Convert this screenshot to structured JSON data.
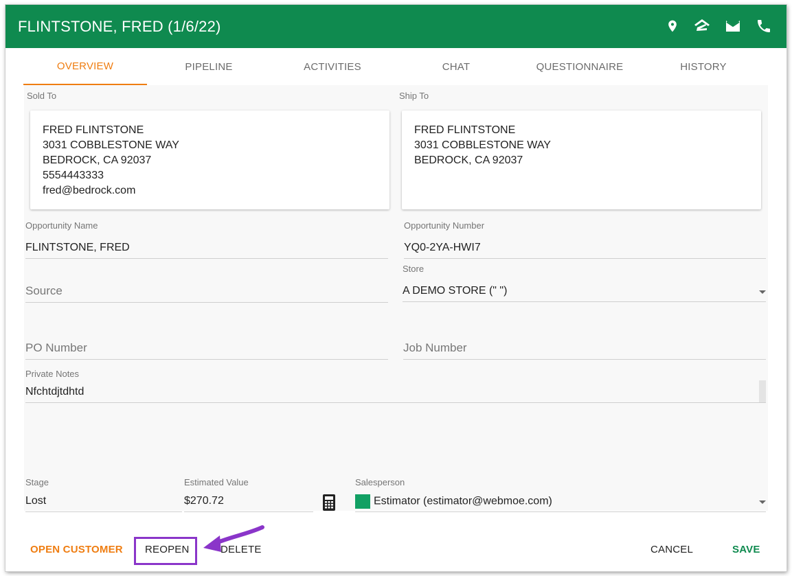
{
  "header": {
    "title": "FLINTSTONE, FRED (1/6/22)",
    "icons": [
      "location-pin-icon",
      "zillow-icon",
      "email-icon",
      "phone-icon"
    ]
  },
  "tabs": [
    {
      "label": "OVERVIEW",
      "active": true
    },
    {
      "label": "PIPELINE",
      "active": false
    },
    {
      "label": "ACTIVITIES",
      "active": false
    },
    {
      "label": "CHAT",
      "active": false
    },
    {
      "label": "QUESTIONNAIRE",
      "active": false
    },
    {
      "label": "HISTORY",
      "active": false
    }
  ],
  "sold_to": {
    "label": "Sold To",
    "lines": [
      "FRED FLINTSTONE",
      "3031 COBBLESTONE WAY",
      "BEDROCK, CA 92037",
      "5554443333",
      "fred@bedrock.com"
    ]
  },
  "ship_to": {
    "label": "Ship To",
    "lines": [
      "FRED FLINTSTONE",
      "3031 COBBLESTONE WAY",
      "BEDROCK, CA 92037"
    ]
  },
  "opportunity_name": {
    "label": "Opportunity Name",
    "value": "FLINTSTONE, FRED"
  },
  "opportunity_number": {
    "label": "Opportunity Number",
    "value": "YQ0-2YA-HWI7"
  },
  "source": {
    "placeholder": "Source"
  },
  "store": {
    "label": "Store",
    "value": "A DEMO STORE (\" \")"
  },
  "po_number": {
    "placeholder": "PO Number"
  },
  "job_number": {
    "placeholder": "Job Number"
  },
  "private_notes": {
    "label": "Private Notes",
    "value": "Nfchtdjtdhtd"
  },
  "stage": {
    "label": "Stage",
    "value": "Lost"
  },
  "estimated_value": {
    "label": "Estimated Value",
    "value": "$270.72"
  },
  "salesperson": {
    "label": "Salesperson",
    "value": "Estimator (estimator@webmoe.com)",
    "color": "#12a064"
  },
  "footer": {
    "open_customer": "OPEN CUSTOMER",
    "reopen": "REOPEN",
    "delete": "DELETE",
    "cancel": "CANCEL",
    "save": "SAVE"
  },
  "colors": {
    "header_bg": "#0f8a4f",
    "accent_orange": "#ef7d11",
    "save_green": "#0f8a4f",
    "annotation_purple": "#8a35c9"
  }
}
